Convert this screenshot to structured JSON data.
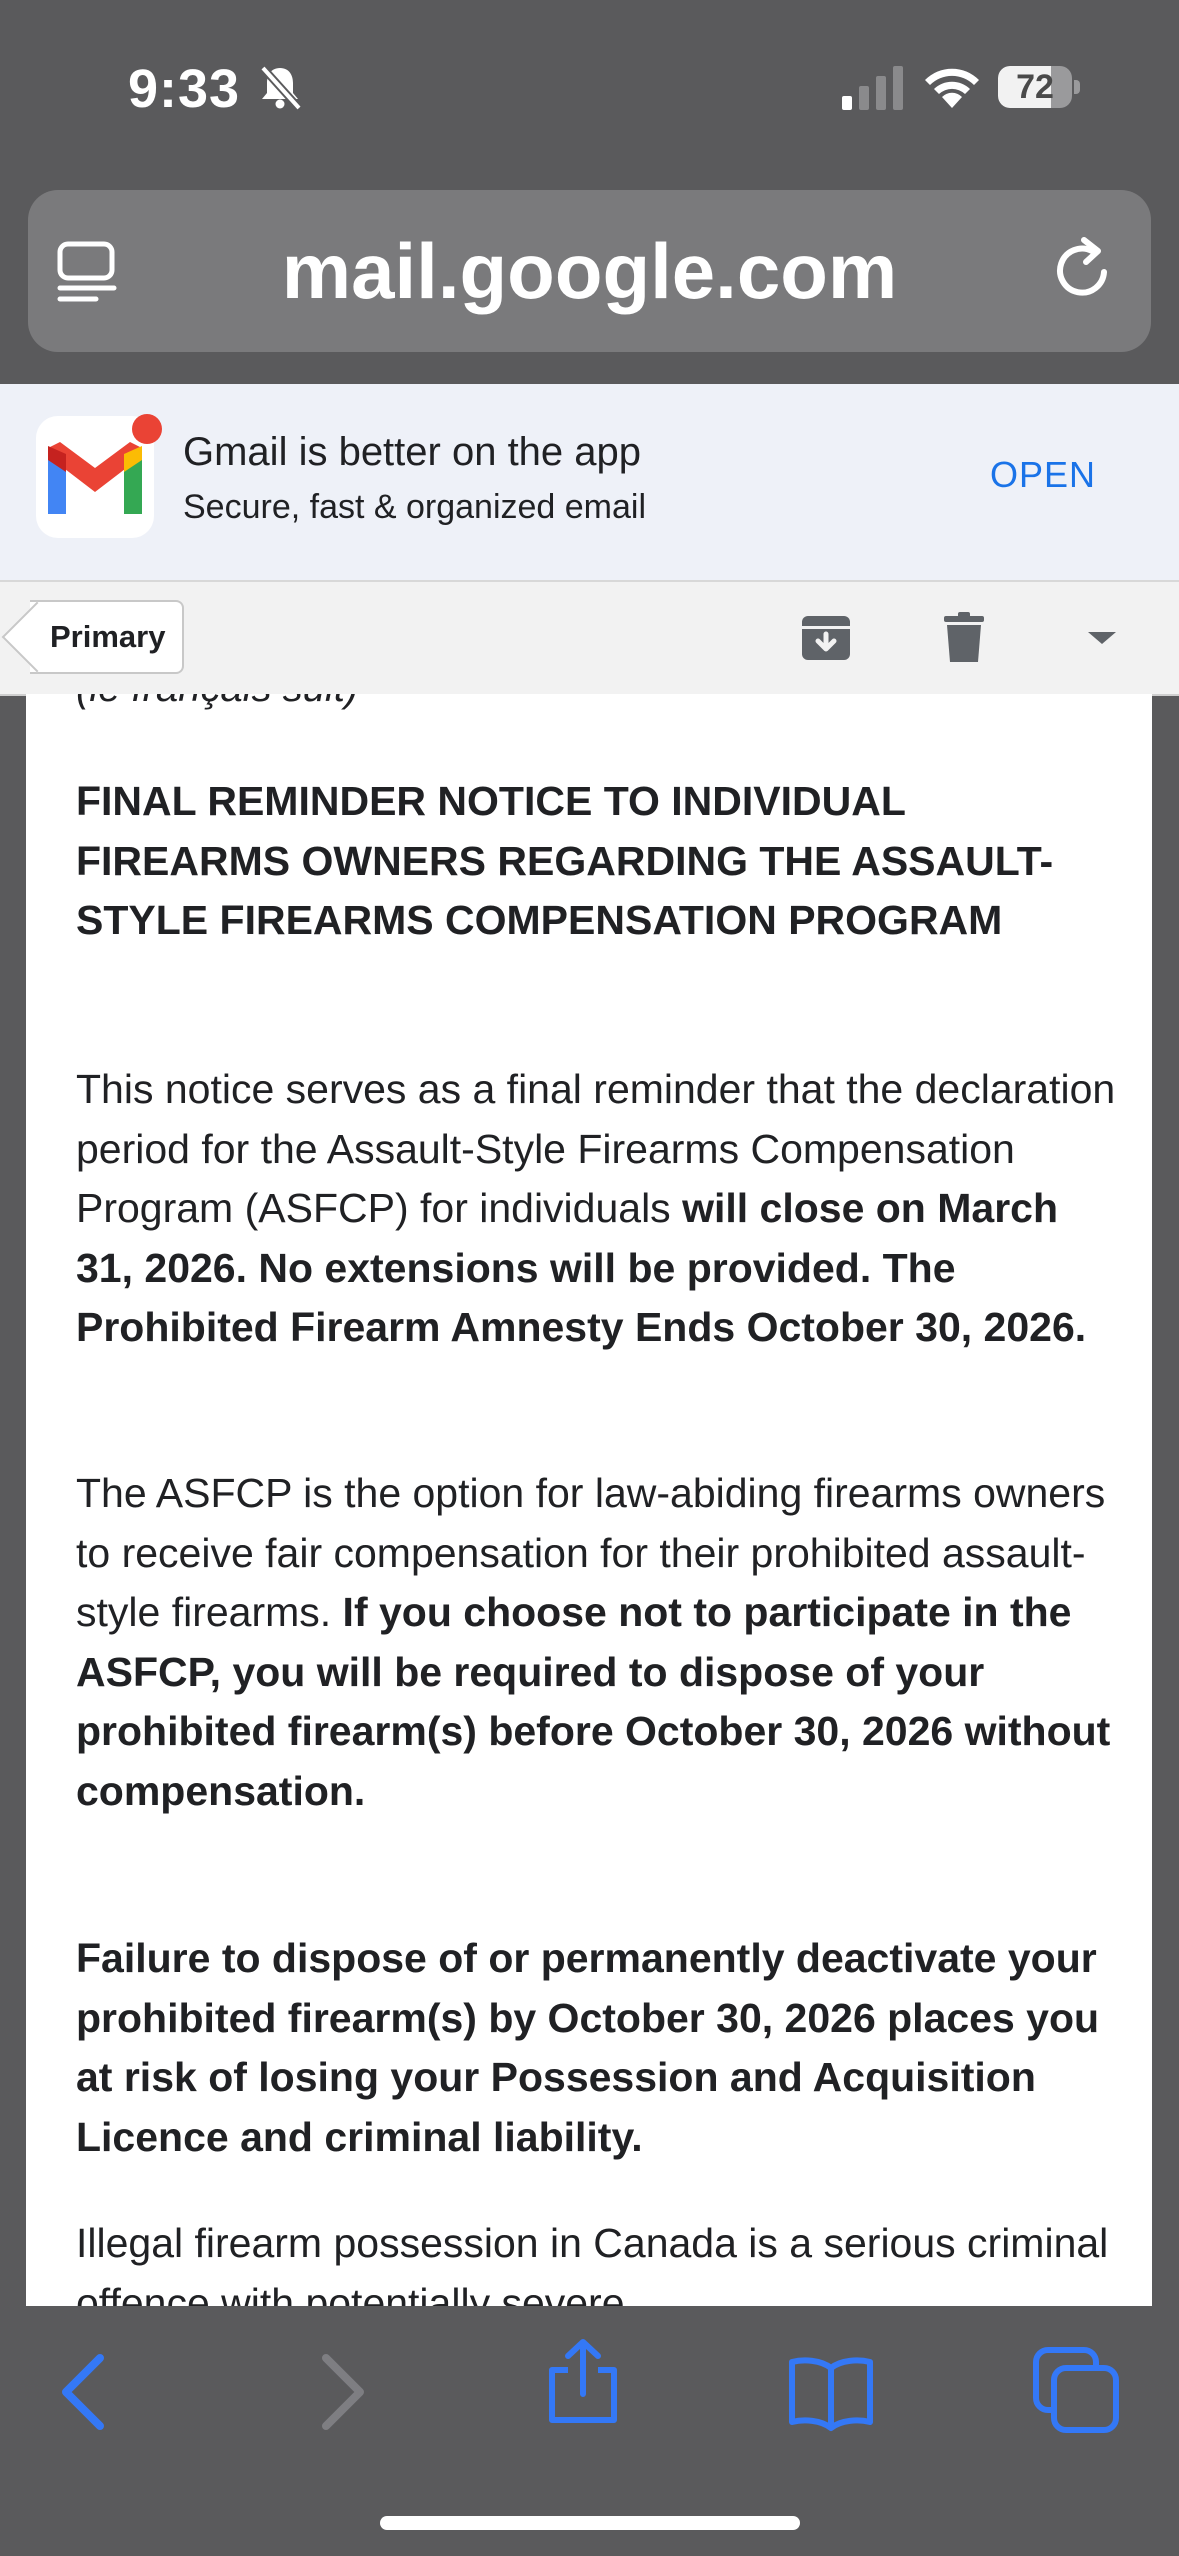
{
  "status_bar": {
    "time": "9:33",
    "battery": "72",
    "battery_level": 0.72
  },
  "address_bar": {
    "url": "mail.google.com"
  },
  "app_banner": {
    "title": "Gmail is better on the app",
    "subtitle": "Secure, fast & organized email",
    "open_label": "OPEN"
  },
  "toolbar": {
    "label_tag": "Primary"
  },
  "email": {
    "lead_line": "(le français suit)",
    "heading": "FINAL REMINDER NOTICE TO INDIVIDUAL FIREARMS OWNERS REGARDING THE ASSAULT-STYLE FIREARMS COMPENSATION PROGRAM",
    "p1_regular": "This notice serves as a final reminder that the declaration period for the Assault-Style Firearms Compensation Program (ASFCP) for individuals ",
    "p1_bold": "will close on March 31, 2026. No extensions will be provided. The Prohibited Firearm Amnesty Ends October 30, 2026.",
    "p2_regular": "The ASFCP is the option for law-abiding firearms owners to receive fair compensation for their prohibited assault-style firearms. ",
    "p2_bold": "If you choose not to participate in the ASFCP, you will be required to dispose of your prohibited firearm(s) before October 30, 2026 without compensation.",
    "p3_bold": "Failure to dispose of or permanently deactivate your prohibited firearm(s) by October 30, 2026 places you at risk of losing your Possession and Acquisition Licence and criminal liability.",
    "p4_regular": "Illegal firearm possession in Canada is a serious criminal offence with potentially severe"
  },
  "colors": {
    "chrome": "#5a5a5c",
    "url_pill": "#7a7a7c",
    "link_blue": "#1a73e8",
    "safari_blue": "#3478f6"
  },
  "icons": {
    "status": [
      "bell-slash-icon",
      "cellular-signal-icon",
      "wifi-icon",
      "battery-icon"
    ],
    "address_bar": [
      "page-menu-icon",
      "reload-icon"
    ],
    "toolbar": [
      "archive-icon",
      "trash-icon",
      "more-dropdown-icon"
    ],
    "bottom_bar": [
      "back-icon",
      "forward-icon",
      "share-icon",
      "bookmarks-icon",
      "tabs-icon"
    ]
  }
}
